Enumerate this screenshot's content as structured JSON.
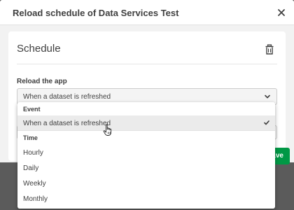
{
  "dialog": {
    "title": "Reload schedule of Data Services Test",
    "close_icon": "close-icon"
  },
  "schedule": {
    "title": "Schedule",
    "delete_icon": "trash-icon",
    "field_label": "Reload the app",
    "selected_value": "When a dataset is refreshed"
  },
  "dropdown": {
    "groups": [
      {
        "label": "Event",
        "options": [
          {
            "label": "When a dataset is refreshed",
            "selected": true
          }
        ]
      },
      {
        "label": "Time",
        "options": [
          {
            "label": "Hourly"
          },
          {
            "label": "Daily"
          },
          {
            "label": "Weekly"
          },
          {
            "label": "Monthly"
          }
        ]
      }
    ]
  },
  "footer": {
    "save_label": "Save"
  },
  "colors": {
    "accent_green": "#009845",
    "selected_row": "#ebebeb",
    "backdrop": "#5b5b5b"
  }
}
